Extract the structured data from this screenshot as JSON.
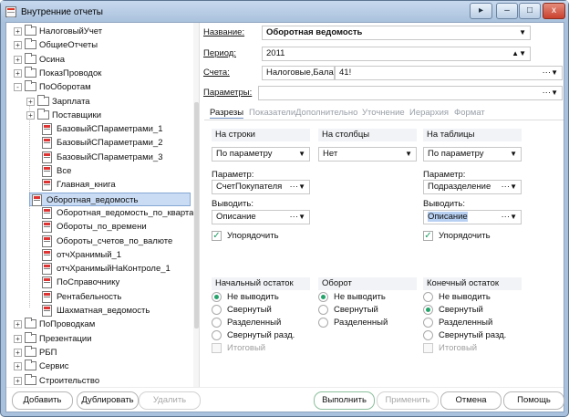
{
  "window": {
    "title": "Внутренние отчеты",
    "controls": {
      "arrow": "▸",
      "minimize": "–",
      "maximize": "□",
      "close": "x"
    }
  },
  "tree": {
    "items": [
      {
        "label": "НалоговыйУчет",
        "type": "folder",
        "expander": "+"
      },
      {
        "label": "ОбщиеОтчеты",
        "type": "folder",
        "expander": "+"
      },
      {
        "label": "Осина",
        "type": "folder",
        "expander": "+"
      },
      {
        "label": "ПоказПроводок",
        "type": "folder",
        "expander": "+"
      },
      {
        "label": "ПоОборотам",
        "type": "folder",
        "expander": "-"
      },
      {
        "label": "Зарплата",
        "type": "folder",
        "expander": "+"
      },
      {
        "label": "Поставщики",
        "type": "folder",
        "expander": "+"
      },
      {
        "label": "БазовыйСПараметрами_1",
        "type": "report"
      },
      {
        "label": "БазовыйСПараметрами_2",
        "type": "report"
      },
      {
        "label": "БазовыйСПараметрами_3",
        "type": "report"
      },
      {
        "label": "Все",
        "type": "report"
      },
      {
        "label": "Главная_книга",
        "type": "report"
      },
      {
        "label": "Оборотная_ведомость",
        "type": "report",
        "selected": true
      },
      {
        "label": "Оборотная_ведомость_по_кварталам",
        "type": "report"
      },
      {
        "label": "Обороты_по_времени",
        "type": "report"
      },
      {
        "label": "Обороты_счетов_по_валюте",
        "type": "report"
      },
      {
        "label": "отчХранимый_1",
        "type": "report"
      },
      {
        "label": "отчХранимыйНаКонтроле_1",
        "type": "report"
      },
      {
        "label": "ПоСправочнику",
        "type": "report"
      },
      {
        "label": "Рентабельность",
        "type": "report"
      },
      {
        "label": "Шахматная_ведомость",
        "type": "report"
      },
      {
        "label": "ПоПроводкам",
        "type": "folder",
        "expander": "+"
      },
      {
        "label": "Презентации",
        "type": "folder",
        "expander": "+"
      },
      {
        "label": "РБП",
        "type": "folder",
        "expander": "+"
      },
      {
        "label": "Сервис",
        "type": "folder",
        "expander": "+"
      },
      {
        "label": "Строительство",
        "type": "folder",
        "expander": "+"
      }
    ]
  },
  "form": {
    "name_label": "Название:",
    "name_value": "Оборотная ведомость",
    "period_label": "Период:",
    "period_value": "2011",
    "accounts_label": "Счета:",
    "accounts_value1": "Налоговые,Бала",
    "accounts_value2": "41!",
    "parameters_label": "Параметры:",
    "parameters_value": "",
    "arrow": "▼",
    "dash": "···",
    "spin": "▲▼"
  },
  "tabs": [
    "Разрезы",
    "Показатели",
    "Дополнительно",
    "Уточнение",
    "Иерархия",
    "Формат"
  ],
  "columns": [
    {
      "heading": "На строки",
      "select": "По параметру",
      "parameter_label": "Параметр:",
      "parameter_value": "СчетПокупателя",
      "output_label": "Выводить:",
      "output_value": "Описание",
      "ordered_label": "Упорядочить"
    },
    {
      "heading": "На столбцы",
      "select": "Нет"
    },
    {
      "heading": "На таблицы",
      "select": "По параметру",
      "parameter_label": "Параметр:",
      "parameter_value": "Подразделение",
      "output_label": "Выводить:",
      "output_value": "Описание",
      "ordered_label": "Упорядочить"
    }
  ],
  "balances": [
    {
      "heading": "Начальный остаток",
      "options": [
        "Не выводить",
        "Свернутый",
        "Разделенный",
        "Свернутый разд."
      ],
      "selected": 0,
      "total": "Итоговый"
    },
    {
      "heading": "Оборот",
      "options": [
        "Не выводить",
        "Свернутый",
        "Разделенный"
      ],
      "selected": 0
    },
    {
      "heading": "Конечный остаток",
      "options": [
        "Не выводить",
        "Свернутый",
        "Разделенный",
        "Свернутый разд."
      ],
      "selected": 1,
      "total": "Итоговый"
    }
  ],
  "buttons": {
    "add": "Добавить",
    "duplicate": "Дублировать",
    "delete": "Удалить",
    "execute": "Выполнить",
    "apply": "Применить",
    "cancel": "Отмена",
    "help": "Помощь"
  },
  "colors": {
    "window_frame": "#a9c1dc",
    "selected_row": "#c9dcf4",
    "check_green": "#24a36a"
  }
}
